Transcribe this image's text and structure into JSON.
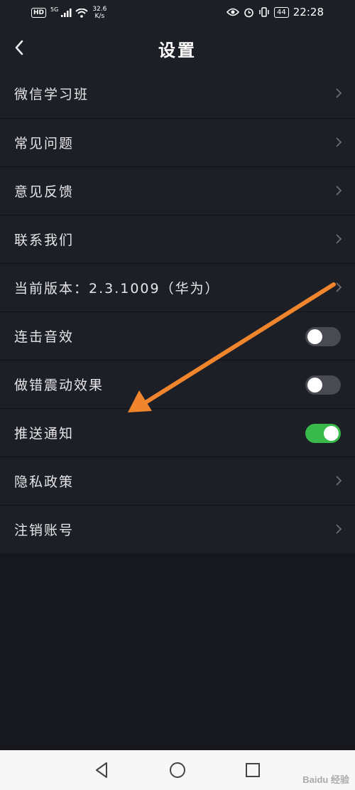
{
  "status_bar": {
    "hd": "HD",
    "net": "5G",
    "speed_value": "32.6",
    "speed_unit": "K/s",
    "battery": "44",
    "time": "22:28"
  },
  "header": {
    "title": "设置"
  },
  "settings": {
    "items": [
      {
        "label": "微信学习班"
      },
      {
        "label": "常见问题"
      },
      {
        "label": "意见反馈"
      },
      {
        "label": "联系我们"
      },
      {
        "label": "当前版本：2.3.1009（华为）"
      },
      {
        "label": "连击音效",
        "toggle": false
      },
      {
        "label": "做错震动效果",
        "toggle": false
      },
      {
        "label": "推送通知",
        "toggle": true
      },
      {
        "label": "隐私政策"
      },
      {
        "label": "注销账号"
      }
    ]
  },
  "watermark": "Baidu 经验",
  "colors": {
    "toggle_on": "#39b94a",
    "annotation_arrow": "#f0852d"
  }
}
